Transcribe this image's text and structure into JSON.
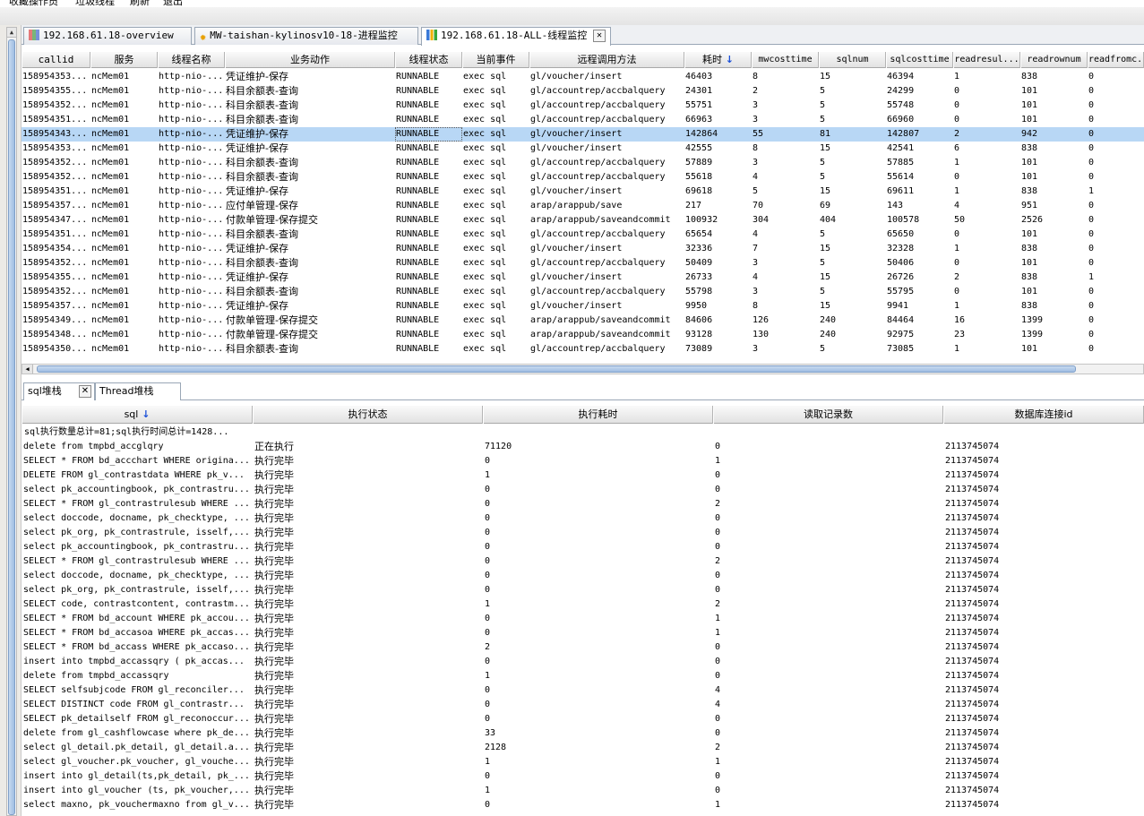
{
  "menubar": {
    "items": [
      "收藏操作员",
      "垃圾线程",
      "刷新",
      "退出"
    ]
  },
  "tabs": [
    {
      "label": "192.168.61.18-overview",
      "icon": "grid-icon"
    },
    {
      "label": "MW-taishan-kylinosv10-18-进程监控",
      "icon": "sun-icon"
    },
    {
      "label": "192.168.61.18-ALL-线程监控",
      "icon": "bar-chart-icon",
      "active": true,
      "close": "✕"
    }
  ],
  "thread_table": {
    "sort_indicator": "↓",
    "columns": [
      "callid",
      "服务",
      "线程名称",
      "业务动作",
      "线程状态",
      "当前事件",
      "远程调用方法",
      "耗时",
      "mwcosttime",
      "sqlnum",
      "sqlcosttime",
      "readresul...",
      "readrownum",
      "readfromc..."
    ],
    "rows": [
      [
        "158954353...",
        "ncMem01",
        "http-nio-...",
        "凭证维护-保存",
        "RUNNABLE",
        "exec sql",
        "gl/voucher/insert",
        "46403",
        "8",
        "15",
        "46394",
        "1",
        "838",
        "0"
      ],
      [
        "158954355...",
        "ncMem01",
        "http-nio-...",
        "科目余额表-查询",
        "RUNNABLE",
        "exec sql",
        "gl/accountrep/accbalquery",
        "24301",
        "2",
        "5",
        "24299",
        "0",
        "101",
        "0"
      ],
      [
        "158954352...",
        "ncMem01",
        "http-nio-...",
        "科目余额表-查询",
        "RUNNABLE",
        "exec sql",
        "gl/accountrep/accbalquery",
        "55751",
        "3",
        "5",
        "55748",
        "0",
        "101",
        "0"
      ],
      [
        "158954351...",
        "ncMem01",
        "http-nio-...",
        "科目余额表-查询",
        "RUNNABLE",
        "exec sql",
        "gl/accountrep/accbalquery",
        "66963",
        "3",
        "5",
        "66960",
        "0",
        "101",
        "0"
      ],
      [
        "158954343...",
        "ncMem01",
        "http-nio-...",
        "凭证维护-保存",
        "RUNNABLE",
        "exec sql",
        "gl/voucher/insert",
        "142864",
        "55",
        "81",
        "142807",
        "2",
        "942",
        "0"
      ],
      [
        "158954353...",
        "ncMem01",
        "http-nio-...",
        "凭证维护-保存",
        "RUNNABLE",
        "exec sql",
        "gl/voucher/insert",
        "42555",
        "8",
        "15",
        "42541",
        "6",
        "838",
        "0"
      ],
      [
        "158954352...",
        "ncMem01",
        "http-nio-...",
        "科目余额表-查询",
        "RUNNABLE",
        "exec sql",
        "gl/accountrep/accbalquery",
        "57889",
        "3",
        "5",
        "57885",
        "1",
        "101",
        "0"
      ],
      [
        "158954352...",
        "ncMem01",
        "http-nio-...",
        "科目余额表-查询",
        "RUNNABLE",
        "exec sql",
        "gl/accountrep/accbalquery",
        "55618",
        "4",
        "5",
        "55614",
        "0",
        "101",
        "0"
      ],
      [
        "158954351...",
        "ncMem01",
        "http-nio-...",
        "凭证维护-保存",
        "RUNNABLE",
        "exec sql",
        "gl/voucher/insert",
        "69618",
        "5",
        "15",
        "69611",
        "1",
        "838",
        "1"
      ],
      [
        "158954357...",
        "ncMem01",
        "http-nio-...",
        "应付单管理-保存",
        "RUNNABLE",
        "exec sql",
        "arap/arappub/save",
        "217",
        "70",
        "69",
        "143",
        "4",
        "951",
        "0"
      ],
      [
        "158954347...",
        "ncMem01",
        "http-nio-...",
        "付款单管理-保存提交",
        "RUNNABLE",
        "exec sql",
        "arap/arappub/saveandcommit",
        "100932",
        "304",
        "404",
        "100578",
        "50",
        "2526",
        "0"
      ],
      [
        "158954351...",
        "ncMem01",
        "http-nio-...",
        "科目余额表-查询",
        "RUNNABLE",
        "exec sql",
        "gl/accountrep/accbalquery",
        "65654",
        "4",
        "5",
        "65650",
        "0",
        "101",
        "0"
      ],
      [
        "158954354...",
        "ncMem01",
        "http-nio-...",
        "凭证维护-保存",
        "RUNNABLE",
        "exec sql",
        "gl/voucher/insert",
        "32336",
        "7",
        "15",
        "32328",
        "1",
        "838",
        "0"
      ],
      [
        "158954352...",
        "ncMem01",
        "http-nio-...",
        "科目余额表-查询",
        "RUNNABLE",
        "exec sql",
        "gl/accountrep/accbalquery",
        "50409",
        "3",
        "5",
        "50406",
        "0",
        "101",
        "0"
      ],
      [
        "158954355...",
        "ncMem01",
        "http-nio-...",
        "凭证维护-保存",
        "RUNNABLE",
        "exec sql",
        "gl/voucher/insert",
        "26733",
        "4",
        "15",
        "26726",
        "2",
        "838",
        "1"
      ],
      [
        "158954352...",
        "ncMem01",
        "http-nio-...",
        "科目余额表-查询",
        "RUNNABLE",
        "exec sql",
        "gl/accountrep/accbalquery",
        "55798",
        "3",
        "5",
        "55795",
        "0",
        "101",
        "0"
      ],
      [
        "158954357...",
        "ncMem01",
        "http-nio-...",
        "凭证维护-保存",
        "RUNNABLE",
        "exec sql",
        "gl/voucher/insert",
        "9950",
        "8",
        "15",
        "9941",
        "1",
        "838",
        "0"
      ],
      [
        "158954349...",
        "ncMem01",
        "http-nio-...",
        "付款单管理-保存提交",
        "RUNNABLE",
        "exec sql",
        "arap/arappub/saveandcommit",
        "84606",
        "126",
        "240",
        "84464",
        "16",
        "1399",
        "0"
      ],
      [
        "158954348...",
        "ncMem01",
        "http-nio-...",
        "付款单管理-保存提交",
        "RUNNABLE",
        "exec sql",
        "arap/arappub/saveandcommit",
        "93128",
        "130",
        "240",
        "92975",
        "23",
        "1399",
        "0"
      ],
      [
        "158954350...",
        "ncMem01",
        "http-nio-...",
        "科目余额表-查询",
        "RUNNABLE",
        "exec sql",
        "gl/accountrep/accbalquery",
        "73089",
        "3",
        "5",
        "73085",
        "1",
        "101",
        "0"
      ]
    ]
  },
  "bottom_tabs": [
    {
      "label": "sql堆栈",
      "close": "✕",
      "active": true
    },
    {
      "label": "Thread堆栈"
    }
  ],
  "sql_table": {
    "sort_indicator": "↓",
    "columns": [
      "sql",
      "执行状态",
      "执行耗时",
      "读取记录数",
      "数据库连接id"
    ],
    "summary": "sql执行数量总计=81;sql执行时间总计=1428...",
    "rows": [
      [
        " delete from tmpbd_accglqry",
        "正在执行",
        "71120",
        "0",
        "2113745074"
      ],
      [
        "SELECT * FROM bd_accchart WHERE origina...",
        "执行完毕",
        "0",
        "1",
        "2113745074"
      ],
      [
        " DELETE FROM gl_contrastdata WHERE pk_v...",
        "执行完毕",
        "1",
        "0",
        "2113745074"
      ],
      [
        "select pk_accountingbook, pk_contrastru...",
        "执行完毕",
        "0",
        "0",
        "2113745074"
      ],
      [
        "SELECT * FROM gl_contrastrulesub WHERE ...",
        "执行完毕",
        "0",
        "2",
        "2113745074"
      ],
      [
        "select doccode, docname, pk_checktype, ...",
        "执行完毕",
        "0",
        "0",
        "2113745074"
      ],
      [
        "select pk_org, pk_contrastrule, isself,...",
        "执行完毕",
        "0",
        "0",
        "2113745074"
      ],
      [
        "select pk_accountingbook, pk_contrastru...",
        "执行完毕",
        "0",
        "0",
        "2113745074"
      ],
      [
        "SELECT * FROM gl_contrastrulesub WHERE ...",
        "执行完毕",
        "0",
        "2",
        "2113745074"
      ],
      [
        "select doccode, docname, pk_checktype, ...",
        "执行完毕",
        "0",
        "0",
        "2113745074"
      ],
      [
        "select pk_org, pk_contrastrule, isself,...",
        "执行完毕",
        "0",
        "0",
        "2113745074"
      ],
      [
        "SELECT code, contrastcontent, contrastm...",
        "执行完毕",
        "1",
        "2",
        "2113745074"
      ],
      [
        "SELECT * FROM bd_account WHERE pk_accou...",
        "执行完毕",
        "0",
        "1",
        "2113745074"
      ],
      [
        "SELECT * FROM bd_accasoa WHERE pk_accas...",
        "执行完毕",
        "0",
        "1",
        "2113745074"
      ],
      [
        "SELECT * FROM bd_accass WHERE pk_accaso...",
        "执行完毕",
        "2",
        "0",
        "2113745074"
      ],
      [
        " insert into tmpbd_accassqry ( pk_accas...",
        "执行完毕",
        "0",
        "0",
        "2113745074"
      ],
      [
        " delete from tmpbd_accassqry",
        "执行完毕",
        "1",
        "0",
        "2113745074"
      ],
      [
        " SELECT selfsubjcode FROM gl_reconciler...",
        "执行完毕",
        "0",
        "4",
        "2113745074"
      ],
      [
        " SELECT DISTINCT code FROM gl_contrastr...",
        "执行完毕",
        "0",
        "4",
        "2113745074"
      ],
      [
        "SELECT pk_detailself FROM gl_reconoccur...",
        "执行完毕",
        "0",
        "0",
        "2113745074"
      ],
      [
        "delete from gl_cashflowcase where pk_de...",
        "执行完毕",
        "33",
        "0",
        "2113745074"
      ],
      [
        "select gl_detail.pk_detail, gl_detail.a...",
        "执行完毕",
        "2128",
        "2",
        "2113745074"
      ],
      [
        "select gl_voucher.pk_voucher, gl_vouche...",
        "执行完毕",
        "1",
        "1",
        "2113745074"
      ],
      [
        "insert into gl_detail(ts,pk_detail, pk_...",
        "执行完毕",
        "0",
        "0",
        "2113745074"
      ],
      [
        "insert into gl_voucher (ts, pk_voucher,...",
        "执行完毕",
        "1",
        "0",
        "2113745074"
      ],
      [
        "select maxno, pk_vouchermaxno from gl_v...",
        "执行完毕",
        "0",
        "1",
        "2113745074"
      ]
    ]
  }
}
